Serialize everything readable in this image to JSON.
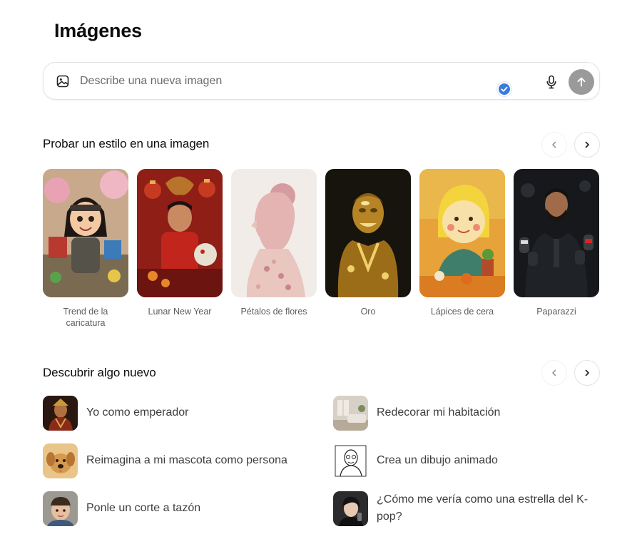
{
  "page": {
    "title": "Imágenes"
  },
  "prompt": {
    "placeholder": "Describe una nueva imagen",
    "image_icon": "image-upload-icon",
    "mic_icon": "microphone-icon",
    "send_icon": "arrow-up-icon",
    "badge_icon": "check-badge-icon"
  },
  "styles_section": {
    "title": "Probar un estilo en una imagen",
    "prev_icon": "chevron-left-icon",
    "next_icon": "chevron-right-icon",
    "items": [
      {
        "label": "Trend de la caricatura"
      },
      {
        "label": "Lunar New Year"
      },
      {
        "label": "Pétalos de flores"
      },
      {
        "label": "Oro"
      },
      {
        "label": "Lápices de cera"
      },
      {
        "label": "Paparazzi"
      }
    ]
  },
  "discover_section": {
    "title": "Descubrir algo nuevo",
    "prev_icon": "chevron-left-icon",
    "next_icon": "chevron-right-icon",
    "items": [
      {
        "label": "Yo como emperador"
      },
      {
        "label": "Redecorar mi habitación"
      },
      {
        "label": "Reimagina a mi mascota como persona"
      },
      {
        "label": "Crea un dibujo animado"
      },
      {
        "label": "Ponle un corte a tazón"
      },
      {
        "label": "¿Cómo me vería como una estrella del K-pop?"
      }
    ]
  },
  "colors": {
    "send_button": "#9a9a9a",
    "badge": "#3a7bde",
    "label_muted": "#5d5d5d"
  }
}
